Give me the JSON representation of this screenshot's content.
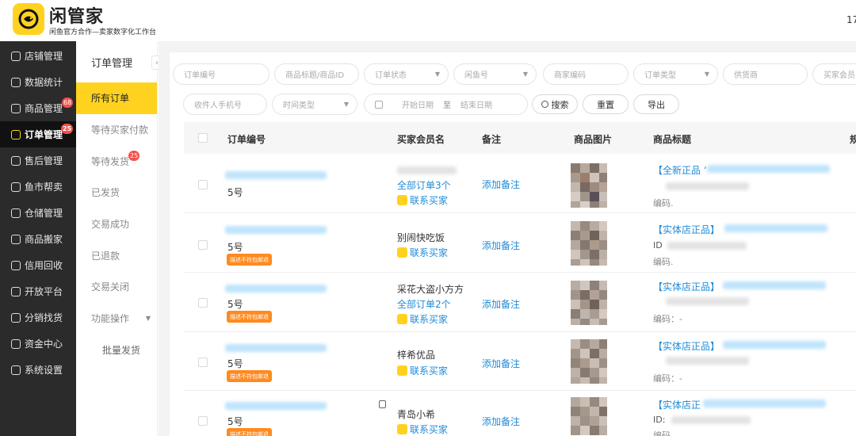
{
  "app": {
    "name": "闲管家",
    "subtitle": "闲鱼官方合作—卖家数字化工作台",
    "header_right": "17"
  },
  "colors": {
    "accent": "#ffd21f",
    "link": "#1e8bd8",
    "badge": "#f2524a",
    "tag": "#ff8a1f",
    "sidebar": "#2b2b2b"
  },
  "sidebar": {
    "items": [
      {
        "label": "店铺管理",
        "icon": "store-icon"
      },
      {
        "label": "数据统计",
        "icon": "grid-icon"
      },
      {
        "label": "商品管理",
        "icon": "goods-icon",
        "badge": "68"
      },
      {
        "label": "订单管理",
        "icon": "order-icon",
        "badge": "25",
        "active": true
      },
      {
        "label": "售后管理",
        "icon": "after-sale-icon"
      },
      {
        "label": "鱼市帮卖",
        "icon": "fish-market-icon"
      },
      {
        "label": "仓储管理",
        "icon": "warehouse-icon"
      },
      {
        "label": "商品搬家",
        "icon": "move-icon"
      },
      {
        "label": "信用回收",
        "icon": "recycle-icon"
      },
      {
        "label": "开放平台",
        "icon": "platform-icon"
      },
      {
        "label": "分销找货",
        "icon": "distribution-icon"
      },
      {
        "label": "资金中心",
        "icon": "fund-icon"
      },
      {
        "label": "系统设置",
        "icon": "settings-icon"
      }
    ]
  },
  "subnav": {
    "title": "订单管理",
    "items": [
      {
        "label": "所有订单",
        "active": true
      },
      {
        "label": "等待买家付款"
      },
      {
        "label": "等待发货",
        "badge": "25"
      },
      {
        "label": "已发货"
      },
      {
        "label": "交易成功"
      },
      {
        "label": "已退款"
      },
      {
        "label": "交易关闭"
      },
      {
        "label": "功能操作"
      },
      {
        "label": "批量发货"
      }
    ]
  },
  "filters": {
    "order_no": "订单编号",
    "product_title": "商品标题/商品ID",
    "order_status": "订单状态",
    "xianyu_no": "闲鱼号",
    "merchant_code": "商家编码",
    "order_type": "订单类型",
    "supplier": "供货商",
    "buyer_member": "买家会员名",
    "receiver_phone": "收件人手机号",
    "time_type": "时间类型",
    "start_date": "开始日期",
    "date_sep": "至",
    "end_date": "结束日期"
  },
  "buttons": {
    "search": "搜索",
    "reset": "重置",
    "export": "导出"
  },
  "table": {
    "headers": [
      "订单编号",
      "买家会员名",
      "备注",
      "商品图片",
      "商品标题",
      "规"
    ],
    "add_note": "添加备注",
    "contact": "联系买家",
    "tag": "描述不符包邮退",
    "rows": [
      {
        "order_suffix": "5号",
        "buyer": "",
        "orders_link": "全部订单3个",
        "title_prefix": "【全新正品",
        "title_mark": "‘",
        "line3": "编码.",
        "has_tag": false
      },
      {
        "order_suffix": "5号",
        "buyer": "别闹快吃饭",
        "orders_link": "",
        "title_prefix": "【实体店正品】",
        "line2": "ID",
        "line3": "编码.",
        "has_tag": true
      },
      {
        "order_suffix": "5号",
        "buyer": "采花大盗小方方",
        "orders_link": "全部订单2个",
        "title_prefix": "【实体店正品】",
        "line3": "编码：-",
        "has_tag": true
      },
      {
        "order_suffix": "5号",
        "buyer": "梓希优品",
        "orders_link": "",
        "title_prefix": "【实体店正品】",
        "line3": "编码：-",
        "has_tag": true
      },
      {
        "order_suffix": "5号",
        "buyer": "青岛小希",
        "orders_link": "",
        "title_prefix": "【实体店正",
        "line2": "ID:",
        "line3": "编码",
        "has_tag": true
      }
    ]
  }
}
